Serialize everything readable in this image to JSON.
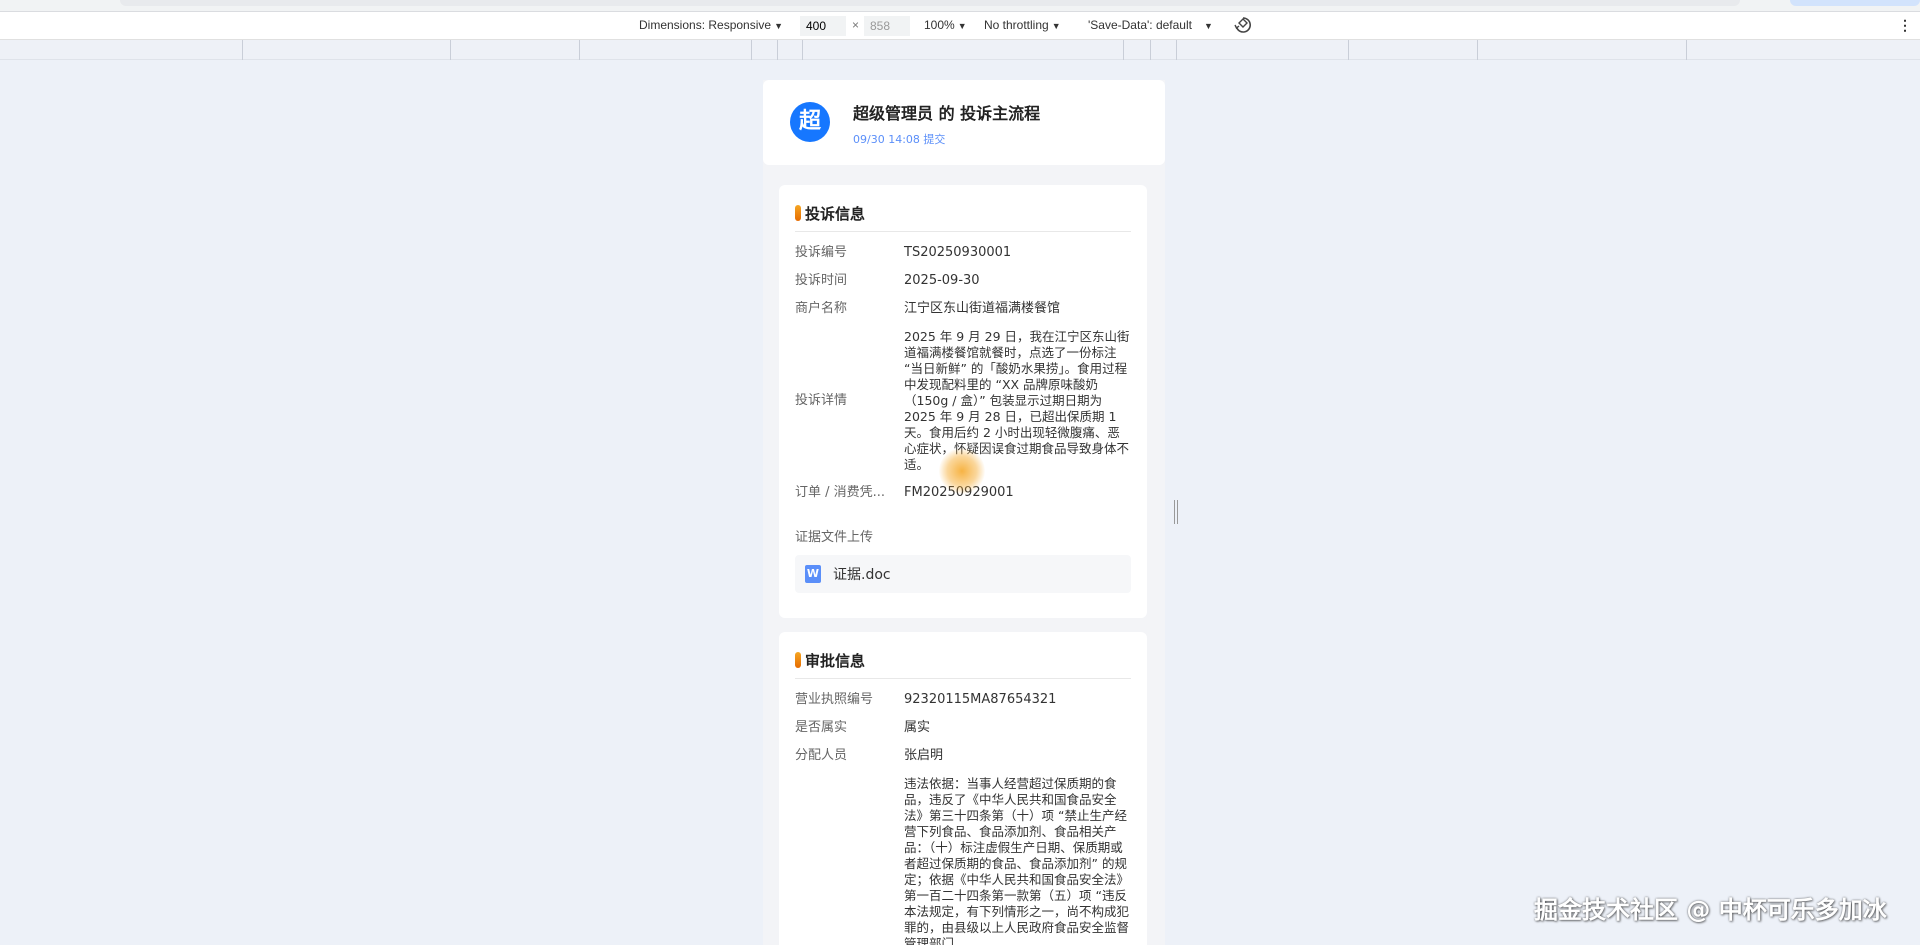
{
  "devtools": {
    "dimensions_label": "Dimensions: Responsive",
    "width_value": "400",
    "times": "×",
    "height_value": "858",
    "zoom": "100%",
    "throttling": "No throttling",
    "save_data": "'Save-Data': default"
  },
  "header": {
    "avatar_text": "超",
    "title": "超级管理员 的 投诉主流程",
    "time": "09/30 14:08 提交"
  },
  "complaint": {
    "title": "投诉信息",
    "rows": [
      {
        "label": "投诉编号",
        "value": "TS20250930001"
      },
      {
        "label": "投诉时间",
        "value": "2025-09-30"
      },
      {
        "label": "商户名称",
        "value": "江宁区东山街道福满楼餐馆"
      },
      {
        "label": "投诉详情",
        "value": "2025 年 9 月 29 日，我在江宁区东山街道福满楼餐馆就餐时，点选了一份标注 “当日新鲜” 的「酸奶水果捞」。食用过程中发现配料里的 “XX 品牌原味酸奶（150g / 盒）” 包装显示过期日期为 2025 年 9 月 28 日，已超出保质期 1 天。食用后约 2 小时出现轻微腹痛、恶心症状，怀疑因误食过期食品导致身体不适。"
      },
      {
        "label": "订单 / 消费凭...",
        "value": "FM20250929001"
      }
    ],
    "upload_label": "证据文件上传",
    "file_name": "证据.doc"
  },
  "approval": {
    "title": "审批信息",
    "rows": [
      {
        "label": "营业执照编号",
        "value": "92320115MA87654321"
      },
      {
        "label": "是否属实",
        "value": "属实"
      },
      {
        "label": "分配人员",
        "value": "张启明"
      },
      {
        "label": "",
        "value": "违法依据：当事人经营超过保质期的食品，违反了《中华人民共和国食品安全法》第三十四条第（十）项 “禁止生产经营下列食品、食品添加剂、食品相关产品：（十）标注虚假生产日期、保质期或者超过保质期的食品、食品添加剂” 的规定；依据《中华人民共和国食品安全法》第一百二十四条第一款第（五）项 “违反本法规定，有下列情形之一，尚不构成犯罪的，由县级以上人民政府食品安全监督管理部门"
      }
    ]
  },
  "watermark": "掘金技术社区 @ 中杯可乐多加冰"
}
